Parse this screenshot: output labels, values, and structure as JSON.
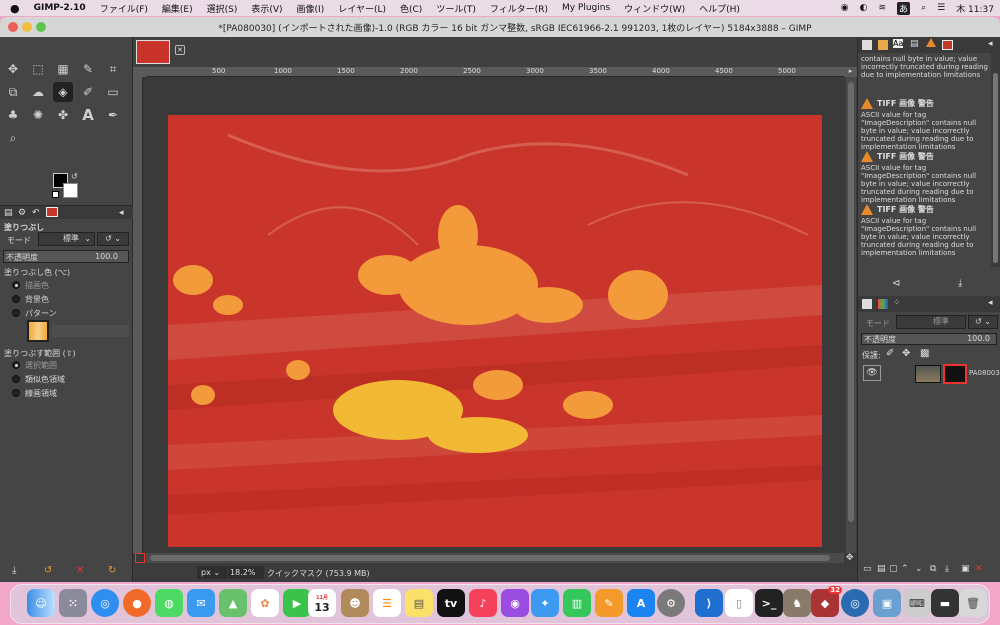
{
  "menubar": {
    "app": "GIMP-2.10",
    "items": [
      "ファイル(F)",
      "編集(E)",
      "選択(S)",
      "表示(V)",
      "画像(I)",
      "レイヤー(L)",
      "色(C)",
      "ツール(T)",
      "フィルター(R)",
      "My Plugins",
      "ウィンドウ(W)",
      "ヘルプ(H)"
    ],
    "ime": "あ",
    "clock": "木 11:37"
  },
  "window": {
    "title": "*[PA080030] (インポートされた画像)-1.0 (RGB カラー 16 bit ガンマ整数, sRGB IEC61966-2.1 991203, 1枚のレイヤー) 5184x3888 – GIMP"
  },
  "tool_options": {
    "title": "塗りつぶし",
    "mode_label": "モード",
    "mode_value": "標準",
    "opacity_label": "不透明度",
    "opacity_value": "100.0",
    "fill_color_label": "塗りつぶし色 (⌥)",
    "fill_options": [
      "描画色",
      "背景色",
      "パターン"
    ],
    "area_label": "塗りつぶす範囲 (⇧)",
    "area_options": [
      "選択範囲",
      "類似色領域",
      "線画領域"
    ]
  },
  "canvas": {
    "ruler_numbers": [
      "500",
      "1000",
      "1500",
      "2000",
      "2500",
      "3000",
      "3500",
      "4000",
      "4500",
      "5000"
    ],
    "unit": "px",
    "zoom": "18.2%",
    "status": "クイックマスク (753.9 MB)"
  },
  "errors": [
    {
      "title": "",
      "text": "contains null byte in value; value incorrectly truncated during reading due to implementation limitations"
    },
    {
      "title": "TIFF 画像 警告",
      "text": "ASCII value for tag \"ImageDescription\" contains null byte in value; value incorrectly truncated during reading due to implementation limitations"
    },
    {
      "title": "TIFF 画像 警告",
      "text": "ASCII value for tag \"ImageDescription\" contains null byte in value; value incorrectly truncated during reading due to implementation limitations"
    },
    {
      "title": "TIFF 画像 警告",
      "text": "ASCII value for tag \"ImageDescription\" contains null byte in value; value incorrectly truncated during reading due to implementation limitations"
    }
  ],
  "layers": {
    "mode_label": "モード",
    "mode_value": "標準",
    "opacity_label": "不透明度",
    "opacity_value": "100.0",
    "lock_label": "保護:",
    "layer_name": "PA08003"
  },
  "dock": {
    "calendar_day": "13",
    "calendar_month": "11月",
    "tv_label": "tv",
    "badge_count": "32"
  }
}
